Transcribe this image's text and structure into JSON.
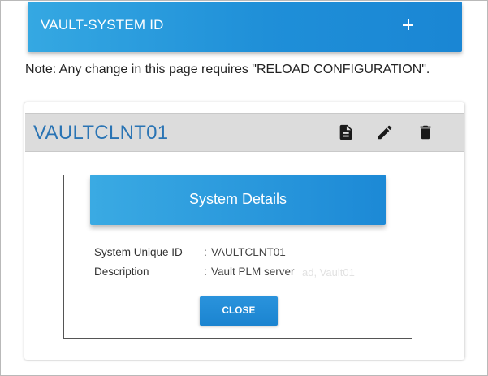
{
  "header": {
    "title": "VAULT-SYSTEM ID",
    "add_icon": "plus-icon",
    "accent_color": "#1f8fd8"
  },
  "note": "Note: Any change in this page requires \"RELOAD CONFIGURATION\".",
  "card": {
    "title": "VAULTCLNT01",
    "title_color": "#2a74b4",
    "actions": [
      {
        "name": "view",
        "icon": "document-icon"
      },
      {
        "name": "edit",
        "icon": "pencil-icon"
      },
      {
        "name": "delete",
        "icon": "trash-icon"
      }
    ]
  },
  "modal": {
    "title": "System Details",
    "rows": [
      {
        "label": "System Unique ID",
        "separator": ":",
        "value": "VAULTCLNT01"
      },
      {
        "label": "Description",
        "separator": ":",
        "value": "Vault PLM server"
      }
    ],
    "ghost_text": "ad, Vault01",
    "close_label": "CLOSE"
  }
}
